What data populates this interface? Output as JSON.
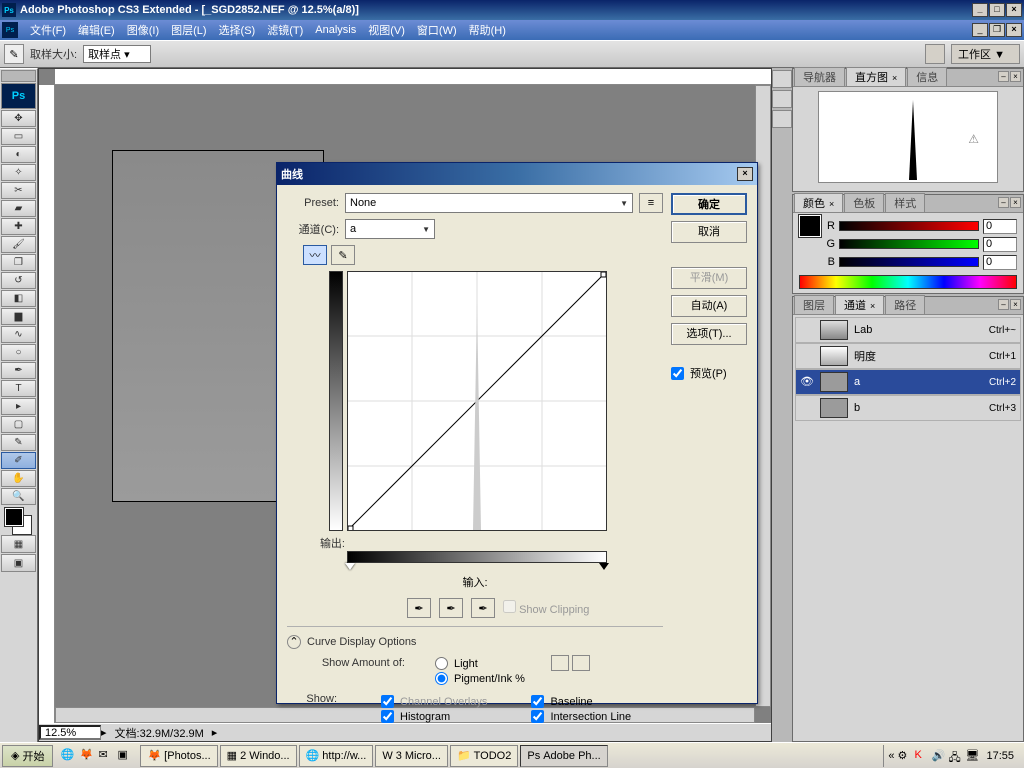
{
  "title": "Adobe Photoshop CS3 Extended - [_SGD2852.NEF @ 12.5%(a/8)]",
  "menu": [
    "文件(F)",
    "编辑(E)",
    "图像(I)",
    "图层(L)",
    "选择(S)",
    "滤镜(T)",
    "Analysis",
    "视图(V)",
    "窗口(W)",
    "帮助(H)"
  ],
  "options": {
    "sample_label": "取样大小:",
    "sample_value": "取样点",
    "workspace": "工作区 ▼"
  },
  "status": {
    "zoom": "12.5%",
    "doc": "文档:32.9M/32.9M"
  },
  "navigator": {
    "tabs": [
      "导航器",
      "直方图",
      "信息"
    ],
    "active": 1
  },
  "color": {
    "tabs": [
      "颜色",
      "色板",
      "样式"
    ],
    "active": 0,
    "r_label": "R",
    "g_label": "G",
    "b_label": "B",
    "r": "0",
    "g": "0",
    "b": "0"
  },
  "channels": {
    "tabs": [
      "图层",
      "通道",
      "路径"
    ],
    "active": 1,
    "rows": [
      {
        "name": "Lab",
        "key": "Ctrl+~",
        "thumb": "lab",
        "eye": false
      },
      {
        "name": "明度",
        "key": "Ctrl+1",
        "thumb": "l",
        "eye": false
      },
      {
        "name": "a",
        "key": "Ctrl+2",
        "thumb": "a",
        "eye": true,
        "selected": true
      },
      {
        "name": "b",
        "key": "Ctrl+3",
        "thumb": "b",
        "eye": false
      }
    ]
  },
  "curves": {
    "title": "曲线",
    "preset_label": "Preset:",
    "preset_value": "None",
    "channel_label": "通道(C):",
    "channel_value": "a",
    "output_label": "输出:",
    "input_label": "输入:",
    "show_clipping": "Show Clipping",
    "display_options": "Curve Display Options",
    "show_amount": "Show Amount of:",
    "light": "Light",
    "pigment": "Pigment/Ink %",
    "show": "Show:",
    "channel_overlays": "Channel Overlays",
    "baseline": "Baseline",
    "histogram": "Histogram",
    "intersection": "Intersection Line",
    "buttons": {
      "ok": "确定",
      "cancel": "取消",
      "smooth": "平滑(M)",
      "auto": "自动(A)",
      "options": "选项(T)..."
    },
    "preview": "预览(P)"
  },
  "taskbar": {
    "start": "开始",
    "tasks": [
      {
        "label": "[Photos..."
      },
      {
        "label": "2 Windo..."
      },
      {
        "label": "http://w..."
      },
      {
        "label": "3 Micro..."
      },
      {
        "label": "TODO2"
      },
      {
        "label": "Adobe Ph...",
        "active": true
      }
    ],
    "clock": "17:55"
  }
}
